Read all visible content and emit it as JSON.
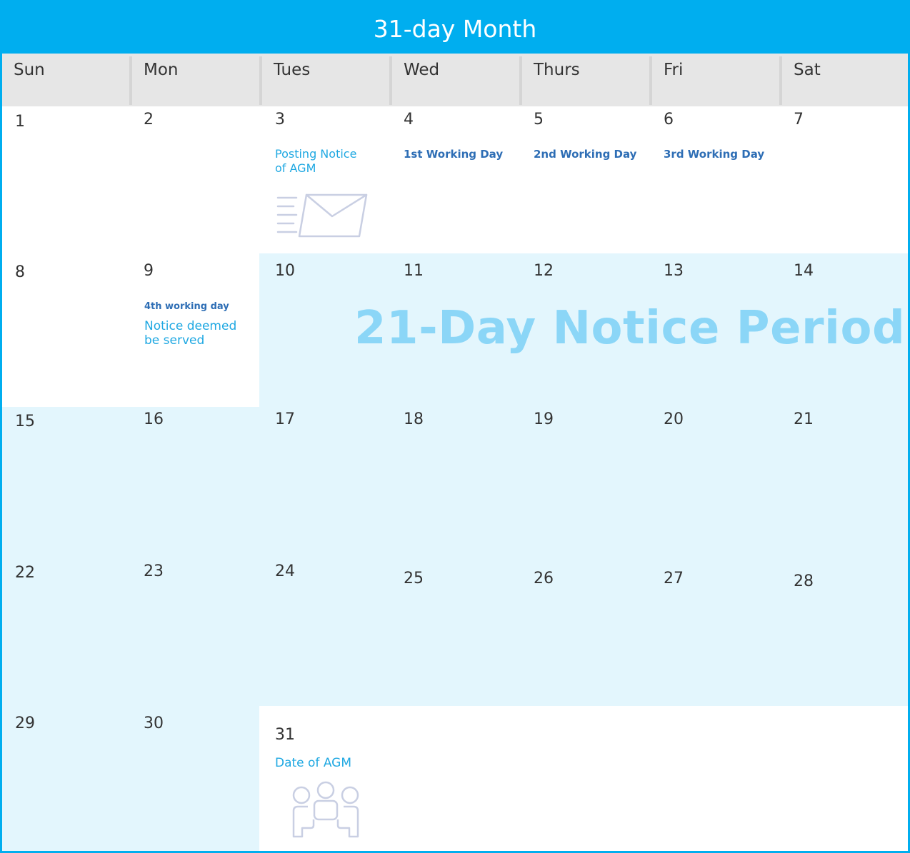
{
  "title": "31-day Month",
  "day_names": [
    "Sun",
    "Mon",
    "Tues",
    "Wed",
    "Thurs",
    "Fri",
    "Sat"
  ],
  "days": [
    "1",
    "2",
    "3",
    "4",
    "5",
    "6",
    "7",
    "8",
    "9",
    "10",
    "11",
    "12",
    "13",
    "14",
    "15",
    "16",
    "17",
    "18",
    "19",
    "20",
    "21",
    "22",
    "23",
    "24",
    "25",
    "26",
    "27",
    "28",
    "29",
    "30",
    "31"
  ],
  "notes": {
    "posting_notice": "Posting Notice\nof AGM",
    "working_day_1": "1st Working Day",
    "working_day_2": "2nd Working Day",
    "working_day_3": "3rd Working Day",
    "working_day_4": "4th working day",
    "notice_deemed": "Notice deemed\nbe served",
    "date_of_agm": "Date of AGM"
  },
  "period_label": "21-Day Notice Period",
  "icons": {
    "posting": "envelope-icon",
    "agm": "meeting-people-icon"
  },
  "colors": {
    "accent": "#00aeef",
    "period_fill": "#e3f6fd",
    "period_text": "#8bd6f7",
    "note_dark": "#2e6eb5",
    "note_light": "#1fa8e2"
  }
}
